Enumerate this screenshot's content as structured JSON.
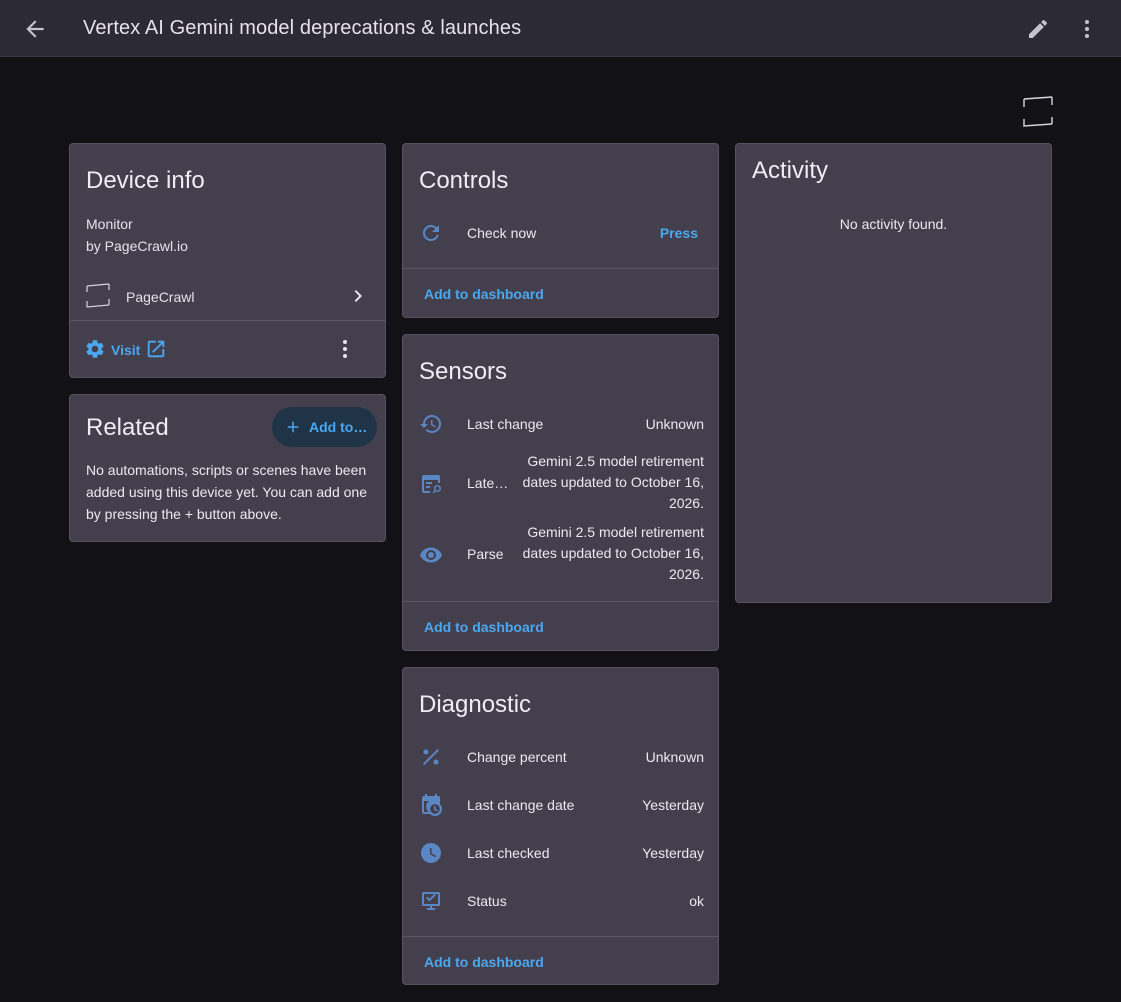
{
  "header": {
    "title": "Vertex AI Gemini model deprecations & launches",
    "back_icon": "arrow-left-icon",
    "edit_icon": "pencil-icon",
    "more_icon": "dots-vertical-icon"
  },
  "device_info": {
    "title": "Device info",
    "model": "Monitor",
    "manufacturer": "by PageCrawl.io",
    "integration": "PageCrawl",
    "visit_label": "Visit"
  },
  "related": {
    "title": "Related",
    "add_button": "Add to…",
    "message": "No automations, scripts or scenes have been added using this device yet. You can add one by pressing the + button above."
  },
  "controls": {
    "title": "Controls",
    "items": [
      {
        "label": "Check now",
        "action": "Press",
        "icon": "refresh-icon"
      }
    ],
    "add_to_dashboard": "Add to dashboard"
  },
  "sensors": {
    "title": "Sensors",
    "items": [
      {
        "label": "Last change",
        "value": "Unknown",
        "icon": "history-icon"
      },
      {
        "label": "Late…",
        "value": "Gemini 2.5 model retirement dates updated to October 16, 2026.",
        "icon": "text-search-icon"
      },
      {
        "label": "Parse",
        "value": "Gemini 2.5 model retirement dates updated to October 16, 2026.",
        "icon": "eye-icon"
      }
    ],
    "add_to_dashboard": "Add to dashboard"
  },
  "diagnostic": {
    "title": "Diagnostic",
    "items": [
      {
        "label": "Change percent",
        "value": "Unknown",
        "icon": "percent-icon"
      },
      {
        "label": "Last change date",
        "value": "Yesterday",
        "icon": "calendar-clock-icon"
      },
      {
        "label": "Last checked",
        "value": "Yesterday",
        "icon": "clock-icon"
      },
      {
        "label": "Status",
        "value": "ok",
        "icon": "monitor-check-icon"
      }
    ],
    "add_to_dashboard": "Add to dashboard"
  },
  "activity": {
    "title": "Activity",
    "empty": "No activity found."
  },
  "colors": {
    "accent": "#4aa8f0",
    "card": "#443f4d",
    "background": "#111116",
    "icon": "#5b86c4"
  }
}
